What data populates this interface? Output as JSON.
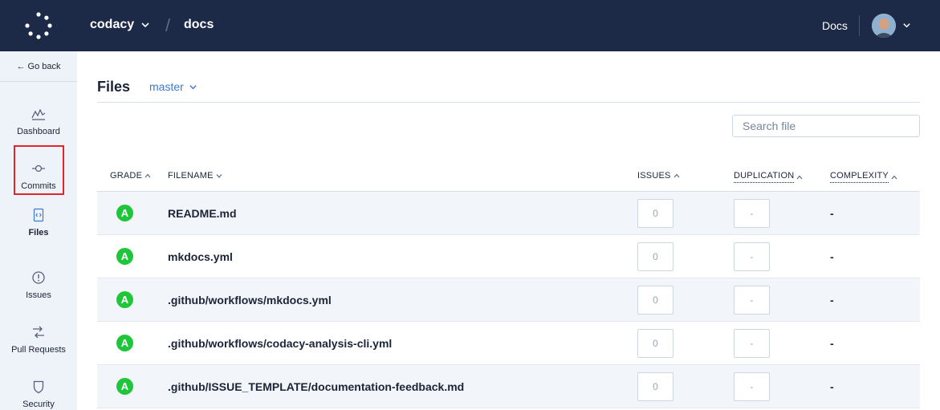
{
  "header": {
    "org": "codacy",
    "repo": "docs",
    "docs_link": "Docs"
  },
  "sidebar": {
    "go_back": "← Go back",
    "items": [
      {
        "label": "Dashboard",
        "icon": "dashboard-icon"
      },
      {
        "label": "Commits",
        "icon": "commit-icon"
      },
      {
        "label": "Files",
        "icon": "file-code-icon",
        "active": true
      },
      {
        "label": "Issues",
        "icon": "issue-icon"
      },
      {
        "label": "Pull Requests",
        "icon": "pull-request-icon"
      },
      {
        "label": "Security",
        "icon": "shield-icon"
      }
    ]
  },
  "main": {
    "title": "Files",
    "branch": "master",
    "search_placeholder": "Search file",
    "columns": {
      "grade": "GRADE",
      "filename": "FILENAME",
      "issues": "ISSUES",
      "duplication": "DUPLICATION",
      "complexity": "COMPLEXITY"
    },
    "rows": [
      {
        "grade": "A",
        "filename": "README.md",
        "issues": "0",
        "duplication": "-",
        "complexity": "-"
      },
      {
        "grade": "A",
        "filename": "mkdocs.yml",
        "issues": "0",
        "duplication": "-",
        "complexity": "-"
      },
      {
        "grade": "A",
        "filename": ".github/workflows/mkdocs.yml",
        "issues": "0",
        "duplication": "-",
        "complexity": "-"
      },
      {
        "grade": "A",
        "filename": ".github/workflows/codacy-analysis-cli.yml",
        "issues": "0",
        "duplication": "-",
        "complexity": "-"
      },
      {
        "grade": "A",
        "filename": ".github/ISSUE_TEMPLATE/documentation-feedback.md",
        "issues": "0",
        "duplication": "-",
        "complexity": "-"
      }
    ]
  },
  "colors": {
    "topbar": "#1c2a47",
    "sidebar": "#eef2f9",
    "grade_a": "#1ec739",
    "accent": "#3a7bd5",
    "highlight_border": "#e0252b"
  }
}
